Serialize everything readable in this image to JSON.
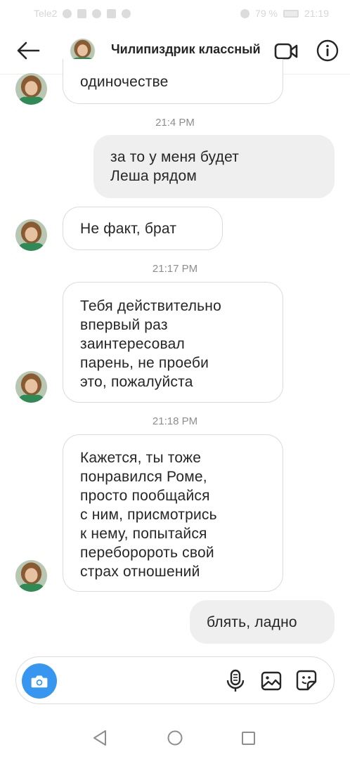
{
  "status_bar": {
    "left_text": "Tele2",
    "battery": "79 %",
    "time": "21:19"
  },
  "header": {
    "back_icon": "arrow-left-icon",
    "title": "Чилипиздрик классный",
    "video_icon": "video-camera-icon",
    "info_icon": "info-icon"
  },
  "messages": [
    {
      "direction": "in",
      "text": "одиночестве"
    },
    {
      "timestamp": "21:4 PM"
    },
    {
      "direction": "out",
      "text": "за то у меня будет\nЛеша рядом"
    },
    {
      "direction": "in",
      "text": "Не факт, брат"
    },
    {
      "timestamp": "21:17 PM"
    },
    {
      "direction": "in",
      "text": "Тебя действительно\nвпервый раз\nзаинтересовал\nпарень, не проеби\nэто, пожалуйста"
    },
    {
      "timestamp": "21:18 PM"
    },
    {
      "direction": "in",
      "text": "Кажется, ты тоже\nпонравился Роме,\nпросто пообщайся\nс ним, присмотрись\nк нему, попытайся\nпереборороть свой\nстрах отношений"
    },
    {
      "direction": "out",
      "text": "блять, ладно"
    }
  ],
  "composer": {
    "placeholder": "",
    "camera_icon": "camera-icon",
    "mic_icon": "microphone-icon",
    "gallery_icon": "image-gallery-icon",
    "sticker_icon": "sticker-icon"
  },
  "nav": {
    "back_icon": "triangle-back-icon",
    "home_icon": "circle-home-icon",
    "recents_icon": "square-recents-icon"
  },
  "colors": {
    "accent": "#3797f0",
    "outgoing_bubble": "#efefef",
    "incoming_border": "#dbdbdb",
    "timestamp": "#8e8e8e"
  }
}
